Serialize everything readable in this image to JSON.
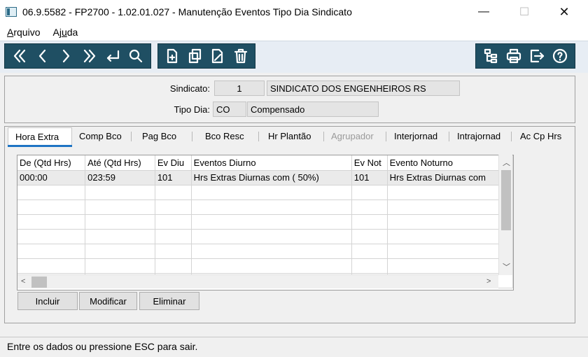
{
  "window": {
    "title": "06.9.5582 - FP2700 - 1.02.01.027 - Manutenção Eventos Tipo Dia Sindicato",
    "minimize_glyph": "—",
    "maximize_glyph": "☐",
    "close_glyph": "✕"
  },
  "menu": {
    "arquivo_first": "A",
    "arquivo_rest": "rquivo",
    "ajuda_first": "Aj",
    "ajuda_ul": "u",
    "ajuda_rest": "da"
  },
  "toolbar": {
    "color": "#1f4f63",
    "nav_icons": [
      "first-icon",
      "previous-icon",
      "next-icon",
      "last-icon",
      "return-icon",
      "search-icon"
    ],
    "edit_icons": [
      "new-record-icon",
      "copy-record-icon",
      "edit-record-icon",
      "delete-icon"
    ],
    "util_icons": [
      "tree-icon",
      "print-icon",
      "exit-icon",
      "help-icon"
    ]
  },
  "header": {
    "sindicato_label": "Sindicato:",
    "sindicato_code": "1",
    "sindicato_name": "SINDICATO DOS ENGENHEIROS RS",
    "tipo_dia_label": "Tipo Dia:",
    "tipo_dia_code": "CO",
    "tipo_dia_name": "Compensado"
  },
  "tabs": [
    {
      "label": "Hora Extra",
      "active": true,
      "disabled": false
    },
    {
      "label": "Comp Bco",
      "active": false,
      "disabled": false
    },
    {
      "label": "Pag Bco",
      "active": false,
      "disabled": false
    },
    {
      "label": "Bco Resc",
      "active": false,
      "disabled": false
    },
    {
      "label": "Hr Plantão",
      "active": false,
      "disabled": false
    },
    {
      "label": "Agrupador",
      "active": false,
      "disabled": true
    },
    {
      "label": "Interjornad",
      "active": false,
      "disabled": false
    },
    {
      "label": "Intrajornad",
      "active": false,
      "disabled": false
    },
    {
      "label": "Ac Cp Hrs",
      "active": false,
      "disabled": false
    }
  ],
  "grid": {
    "columns": [
      "De (Qtd Hrs)",
      "Até (Qtd Hrs)",
      "Ev Diu",
      "Eventos Diurno",
      "Ev Not",
      "Evento Noturno"
    ],
    "rows": [
      [
        "000:00",
        "023:59",
        "101",
        "Hrs Extras Diurnas  com ( 50%)",
        "101",
        "Hrs Extras Diurnas  com"
      ]
    ],
    "empty_rows": 7
  },
  "buttons": {
    "incluir": "Incluir",
    "modificar": "Modificar",
    "eliminar": "Eliminar"
  },
  "status": {
    "message": "Entre os dados ou pressione ESC para sair."
  }
}
